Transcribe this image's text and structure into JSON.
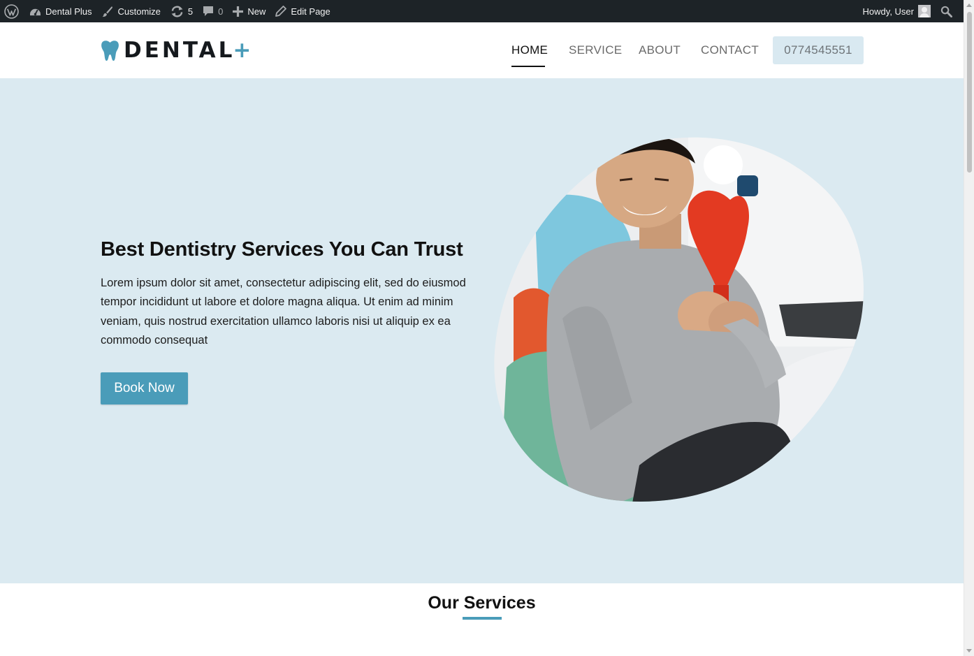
{
  "admin_bar": {
    "site_name": "Dental Plus",
    "customize": "Customize",
    "updates_count": "5",
    "comments_count": "0",
    "new_label": "New",
    "edit_page": "Edit Page",
    "greeting": "Howdy, User",
    "icons": [
      "wordpress-icon",
      "dashboard-icon",
      "brush-icon",
      "updates-icon",
      "comment-icon",
      "plus-icon",
      "pencil-icon",
      "avatar",
      "search-icon"
    ]
  },
  "header": {
    "logo_text": "DENTAL",
    "logo_plus": "+",
    "nav": [
      {
        "label": "HOME",
        "active": true
      },
      {
        "label": "SERVICE",
        "active": false
      },
      {
        "label": "ABOUT",
        "active": false
      },
      {
        "label": "CONTACT",
        "active": false
      }
    ],
    "phone": "0774545551"
  },
  "hero": {
    "title": "Best Dentistry Services You Can Trust",
    "text": "Lorem ipsum dolor sit amet, consectetur adipiscing elit, sed do eiusmod tempor incididunt ut labore et dolore magna aliqua. Ut enim ad minim veniam, quis nostrud exercitation ullamco laboris nisi ut aliquip ex ea commodo consequat",
    "button": "Book Now",
    "image": "smiling-patient-with-tooth-mirror"
  },
  "services": {
    "title": "Our Services"
  },
  "colors": {
    "accent": "#4a9cb9",
    "hero_bg": "#dbeaf1",
    "admin_bar_bg": "#1d2327",
    "phone_bg": "#d9e9f1"
  }
}
